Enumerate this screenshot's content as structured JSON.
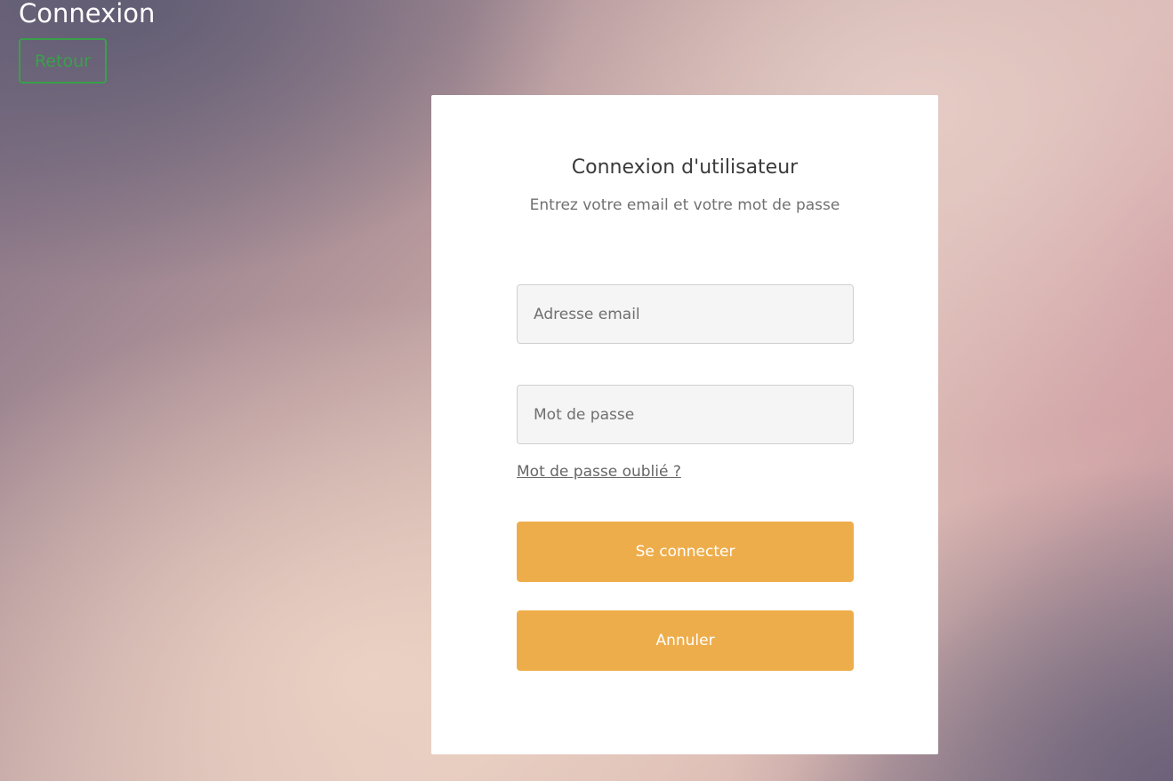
{
  "header": {
    "title": "Connexion",
    "back_label": "Retour"
  },
  "login_card": {
    "title": "Connexion d'utilisateur",
    "subtitle": "Entrez votre email et votre mot de passe",
    "email": {
      "value": "",
      "placeholder": "Adresse email"
    },
    "password": {
      "value": "",
      "placeholder": "Mot de passe"
    },
    "forgot_password_label": "Mot de passe oublié ?",
    "submit_label": "Se connecter",
    "cancel_label": "Annuler"
  },
  "colors": {
    "accent": "#eead4b",
    "back_button": "#3aa04a",
    "card_background": "#ffffff"
  }
}
